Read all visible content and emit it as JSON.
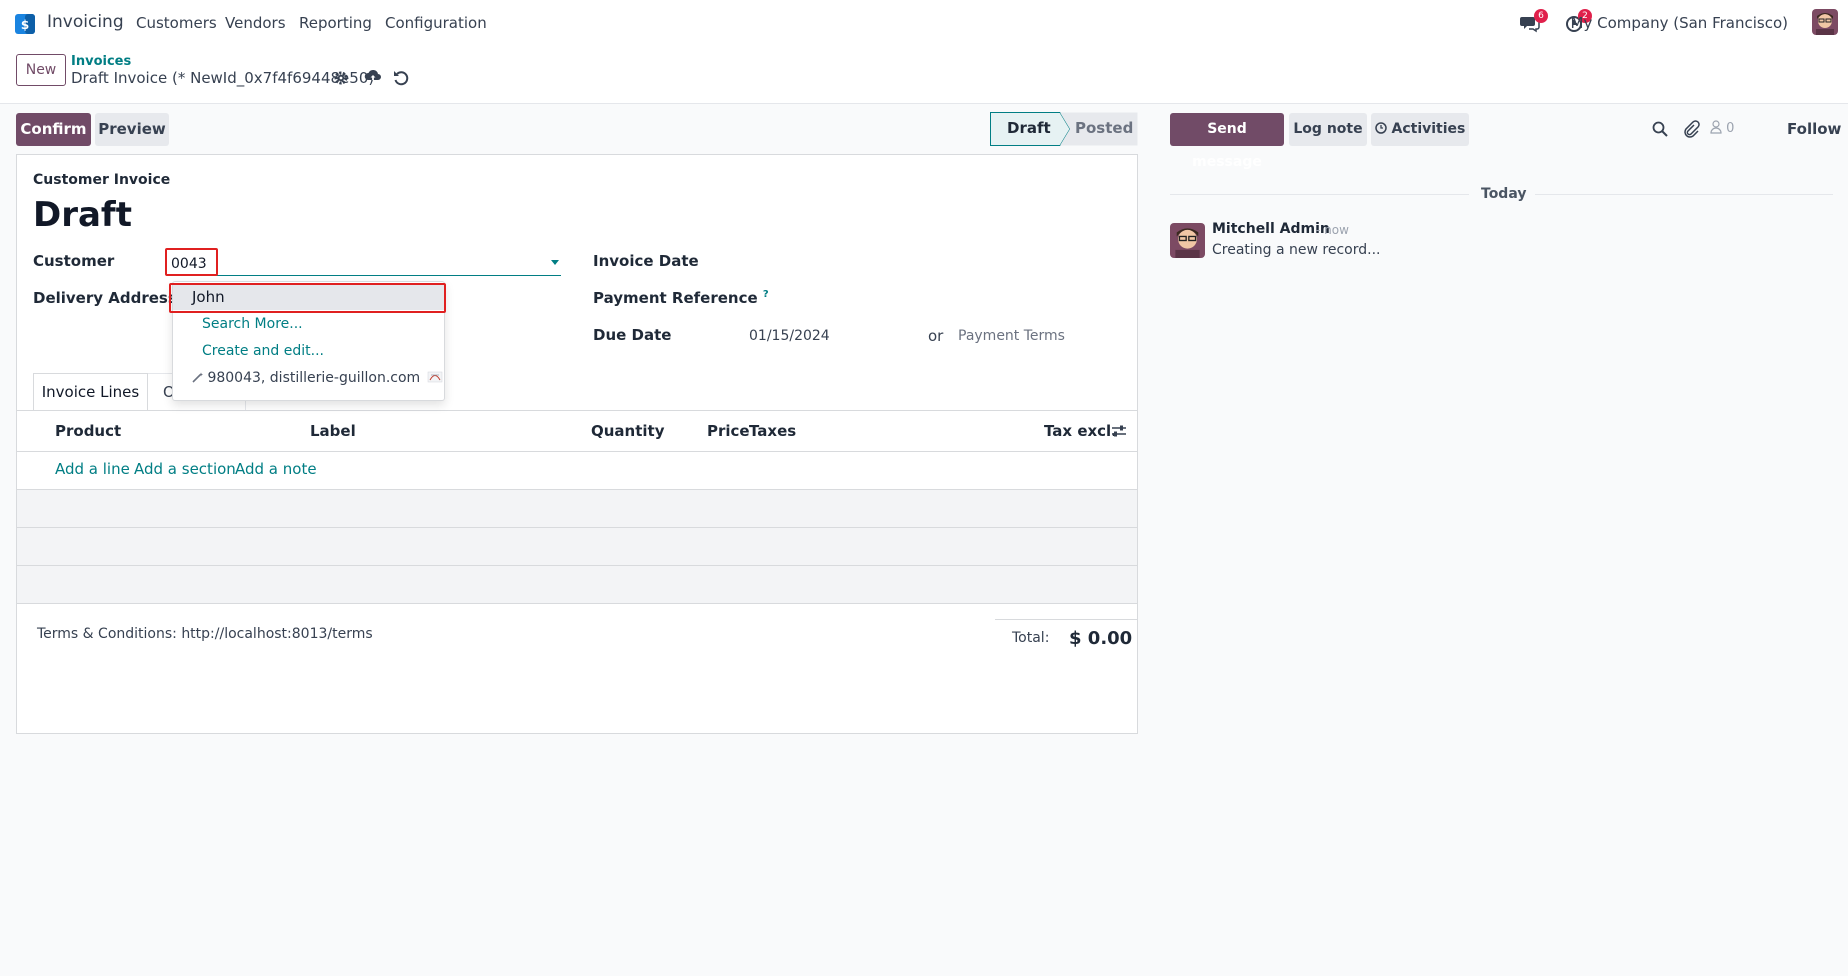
{
  "navbar": {
    "app_name": "Invoicing",
    "menu": [
      "Customers",
      "Vendors",
      "Reporting",
      "Configuration"
    ],
    "messages_badge": "6",
    "activities_badge": "2",
    "company": "My Company (San Francisco)"
  },
  "control_panel": {
    "new_label": "New",
    "breadcrumb": "Invoices",
    "record_name": "Draft Invoice (* NewId_0x7f4f69448e50)"
  },
  "actions": {
    "confirm_label": "Confirm",
    "preview_label": "Preview"
  },
  "status_bar": {
    "steps": [
      "Draft",
      "Posted"
    ],
    "active": "Draft"
  },
  "form": {
    "move_type": "Customer Invoice",
    "state_title": "Draft",
    "customer_label": "Customer",
    "customer_value": "0043",
    "delivery_address_label": "Delivery Address",
    "invoice_date_label": "Invoice Date",
    "payment_reference_label": "Payment Reference",
    "due_date_label": "Due Date",
    "due_date_value": "01/15/2024",
    "or_label": "or",
    "payment_terms_placeholder": "Payment Terms",
    "help_mark": "?"
  },
  "autocomplete": {
    "items": [
      "John",
      "Search More...",
      "Create and edit...",
      "980043, distillerie-guillon.com"
    ]
  },
  "tabs": {
    "invoice_lines": "Invoice Lines",
    "other_partial": "O"
  },
  "lines_table": {
    "headers": [
      "Product",
      "Label",
      "Quantity",
      "Price",
      "Taxes",
      "Tax excl."
    ],
    "add_links": [
      "Add a line",
      "Add a section",
      "Add a note"
    ]
  },
  "footer": {
    "terms": "Terms & Conditions: http://localhost:8013/terms",
    "total_label": "Total:",
    "total_value": "$ 0.00"
  },
  "chatter": {
    "send_message": "Send message",
    "log_note": "Log note",
    "activities": "Activities",
    "followers_count": "0",
    "follow": "Follow",
    "date_separator": "Today",
    "message": {
      "author": "Mitchell Admin",
      "time": "- now",
      "body": "Creating a new record..."
    }
  },
  "colors": {
    "primary": "#714b67",
    "link": "#017e84",
    "badge": "#e0204b",
    "highlight_border": "#e02020"
  }
}
